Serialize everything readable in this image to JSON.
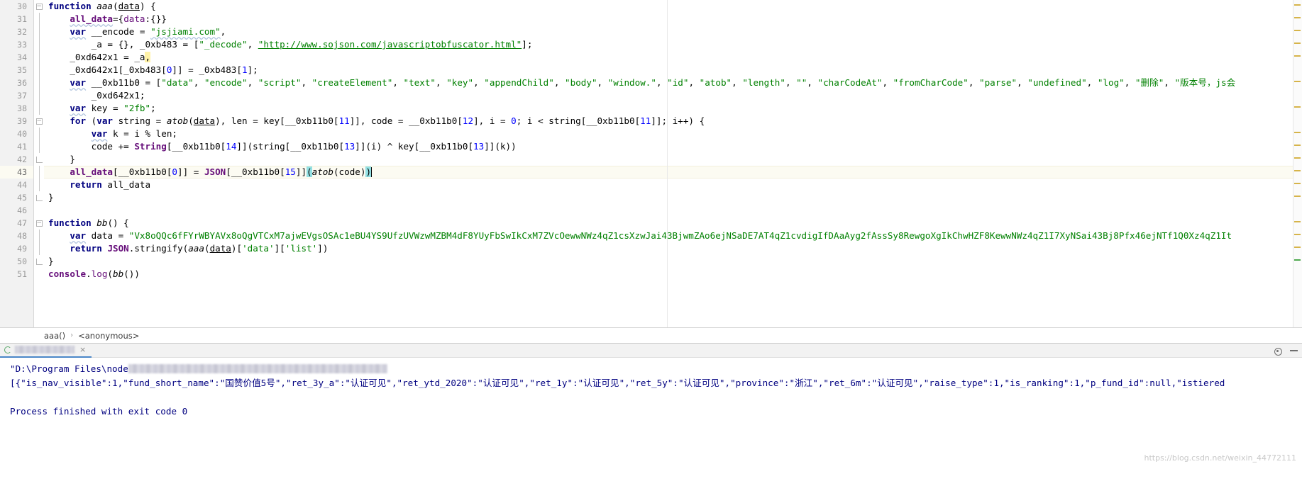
{
  "editor": {
    "first_line_number": 30,
    "current_line": 43,
    "lines": [
      {
        "n": 30,
        "fold": "open",
        "text": "function aaa(data) {"
      },
      {
        "n": 31,
        "fold": "pipe",
        "text": "    all_data={data:{}}"
      },
      {
        "n": 32,
        "fold": "pipe",
        "text": "    var __encode = \"jsjiami.com\","
      },
      {
        "n": 33,
        "fold": "pipe",
        "text": "        _a = {}, _0xb483 = [\"_decode\", \"http://www.sojson.com/javascriptobfuscator.html\"];"
      },
      {
        "n": 34,
        "fold": "pipe",
        "text": "    _0xd642x1 = _a,"
      },
      {
        "n": 35,
        "fold": "pipe",
        "text": "    _0xd642x1[_0xb483[0]] = _0xb483[1];"
      },
      {
        "n": 36,
        "fold": "pipe",
        "text": "    var __0xb11b0 = [\"data\", \"encode\", \"script\", \"createElement\", \"text\", \"key\", \"appendChild\", \"body\", \"window.\", \"id\", \"atob\", \"length\", \"\", \"charCodeAt\", \"fromCharCode\", \"parse\", \"undefined\", \"log\", \"删除\", \"版本号，js会"
      },
      {
        "n": 37,
        "fold": "pipe",
        "text": "        _0xd642x1;"
      },
      {
        "n": 38,
        "fold": "pipe",
        "text": "    var key = \"2fb\";"
      },
      {
        "n": 39,
        "fold": "open",
        "text": "    for (var string = atob(data), len = key[__0xb11b0[11]], code = __0xb11b0[12], i = 0; i < string[__0xb11b0[11]]; i++) {"
      },
      {
        "n": 40,
        "fold": "pipe",
        "text": "        var k = i % len;"
      },
      {
        "n": 41,
        "fold": "pipe",
        "text": "        code += String[__0xb11b0[14]](string[__0xb11b0[13]](i) ^ key[__0xb11b0[13]](k))"
      },
      {
        "n": 42,
        "fold": "end",
        "text": "    }"
      },
      {
        "n": 43,
        "fold": "pipe",
        "text": "    all_data[__0xb11b0[0]] = JSON[__0xb11b0[15]](atob(code))"
      },
      {
        "n": 44,
        "fold": "pipe",
        "text": "    return all_data"
      },
      {
        "n": 45,
        "fold": "end",
        "text": "}"
      },
      {
        "n": 46,
        "fold": "none",
        "text": ""
      },
      {
        "n": 47,
        "fold": "open",
        "text": "function bb() {"
      },
      {
        "n": 48,
        "fold": "pipe",
        "text": "    var data = \"Vx8oQQc6fFYrWBYAVx8oQgVTCxM7ajwEVgsOSAc1eBU4YS9UfzUVWzwMZBM4dF8YUyFbSwIkCxM7ZVcOewwNWz4qZ1csXzwJai43BjwmZAo6ejNSaDE7AT4qZ1cvdigIfDAaAyg2fAssSy8RewgoXgIkChwHZF8KewwNWz4qZ1I7XyNSai43Bj8Pfx46ejNTf1Q0Xz4qZ1It"
      },
      {
        "n": 49,
        "fold": "pipe",
        "text": "    return JSON.stringify(aaa(data)['data']['list'])"
      },
      {
        "n": 50,
        "fold": "end",
        "text": "}"
      },
      {
        "n": 51,
        "fold": "none",
        "text": "console.log(bb())"
      }
    ]
  },
  "breadcrumb": {
    "items": [
      "aaa()",
      "<anonymous>"
    ],
    "separator": "›"
  },
  "run_panel": {
    "tab_label": "",
    "tab_close": "×",
    "settings_icon": "gear-icon",
    "minimize_icon": "minimize-icon"
  },
  "console": {
    "command_prefix": "\"D:\\Program Files\\node",
    "output_json": "[{\"is_nav_visible\":1,\"fund_short_name\":\"国赞价值5号\",\"ret_3y_a\":\"认证可见\",\"ret_ytd_2020\":\"认证可见\",\"ret_1y\":\"认证可见\",\"ret_5y\":\"认证可见\",\"province\":\"浙江\",\"ret_6m\":\"认证可见\",\"raise_type\":1,\"is_ranking\":1,\"p_fund_id\":null,\"istiered",
    "exit_message": "Process finished with exit code 0"
  },
  "watermark": "https://blog.csdn.net/weixin_44772111",
  "colors": {
    "keyword": "#000080",
    "string": "#008000",
    "number": "#0000ff",
    "global_var": "#660e7a",
    "console_text": "#000080",
    "current_line_bg": "#fcfbf2",
    "gutter_bg": "#f2f2f2",
    "accent_tab": "#4a86c8"
  }
}
